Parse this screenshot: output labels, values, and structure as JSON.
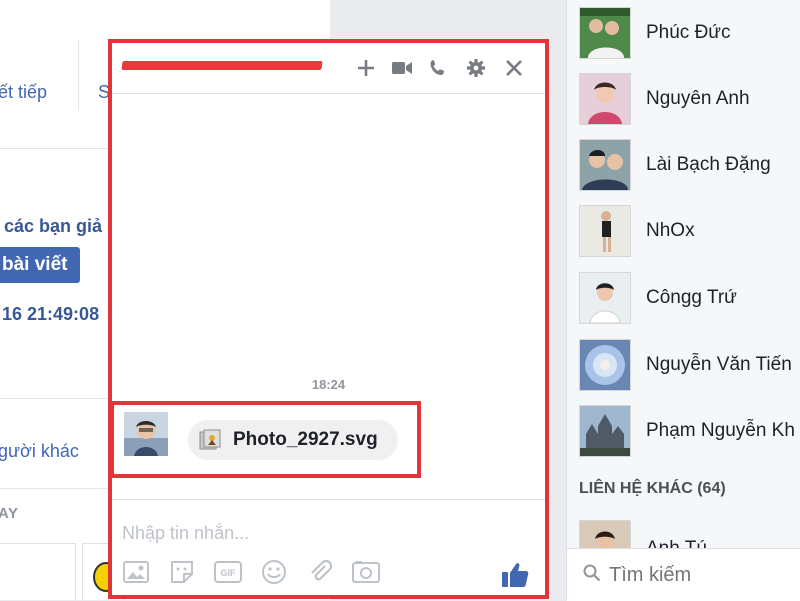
{
  "feed": {
    "continue_text": "ết tiếp",
    "s_text": "S",
    "friends_text": "các bạn giả",
    "write_post": "bài viết",
    "timestamp": "16 21:49:08",
    "others_text": "gười khác",
    "today_label": "AY"
  },
  "chat": {
    "name": "",
    "icons": [
      "plus-icon",
      "video-icon",
      "phone-icon",
      "gear-icon",
      "close-icon"
    ],
    "time": "18:24",
    "attachment_name": "Photo_2927.svg",
    "composer_placeholder": "Nhập tin nhắn...",
    "tools": [
      "photo-icon",
      "sticker-icon",
      "gif-icon",
      "emoji-icon",
      "attach-icon",
      "camera-icon"
    ],
    "accent": "#4267b2",
    "highlight": "#e2353a"
  },
  "sidebar": {
    "contacts": [
      {
        "name": "Phúc Đức"
      },
      {
        "name": "Nguyên Anh"
      },
      {
        "name": "Lài Bạch Đặng"
      },
      {
        "name": "NhOx"
      },
      {
        "name": "Côngg Trứ"
      },
      {
        "name": "Nguyễn Văn Tiến"
      },
      {
        "name": "Phạm Nguyễn Kh"
      }
    ],
    "other_contacts_label": "LIÊN HỆ KHÁC (64)",
    "partial_contact": "Anh Tú",
    "search_placeholder": "Tìm kiếm"
  }
}
